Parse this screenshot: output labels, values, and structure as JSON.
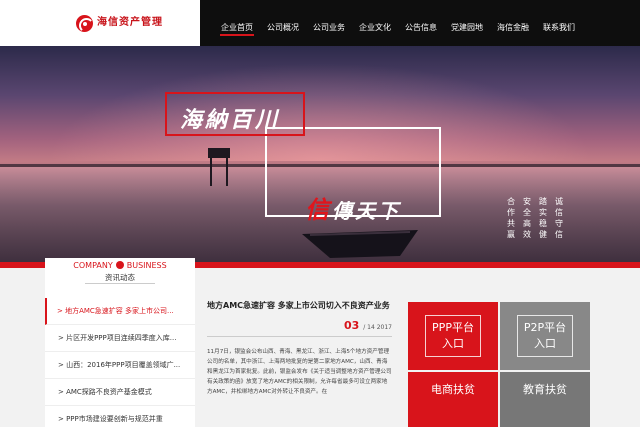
{
  "header": {
    "logo_text": "海信资产管理",
    "nav": [
      "企业首页",
      "公司概况",
      "公司业务",
      "企业文化",
      "公告信息",
      "党建园地",
      "海信金融",
      "联系我们"
    ]
  },
  "banner": {
    "slogan1": "海納百川",
    "slogan2_red": "信",
    "slogan2_rest": "傳天下",
    "poem_cols": [
      "合作共赢",
      "安全高效",
      "踏实稳健",
      "诚信守信"
    ]
  },
  "sidebar": {
    "title_en_left": "COMPANY",
    "title_en_right": "BUSINESS",
    "title_cn": "资讯动态",
    "items": [
      "> 地方AMC急速扩容 多家上市公司...",
      "> 片区开发PPP项目连续四季度入库...",
      "> 山西：2016年PPP项目覆盖领域广...",
      "> AMC探路不良资产基金模式",
      "> PPP市场建设要创新与规范并重"
    ]
  },
  "article": {
    "title": "地方AMC急速扩容 多家上市公司切入不良资产业务",
    "day": "03",
    "monthyear": "/ 14 2017",
    "body": "11月7日，银监会公布山西、青海、黑龙江、浙江、上海5个地方资产管理公司的名单，其中浙江、上海两地批复的是第二家地方AMC，山西、青海和黑龙江为首家批复。此前，银监会发布《关于适当调整地方资产管理公司有关政策的函》放宽了地方AMC的相关限制，允许每省最多可设立两家地方AMC，并松绑地方AMC对外转让不良资产。在"
  },
  "tiles": {
    "a": [
      "PPP平台",
      "入口"
    ],
    "b": [
      "P2P平台",
      "入口"
    ],
    "c": "电商扶贫",
    "d": "教育扶贫"
  },
  "colors": {
    "brand_red": "#d8141b",
    "nav_bg": "#0e0e0e"
  }
}
